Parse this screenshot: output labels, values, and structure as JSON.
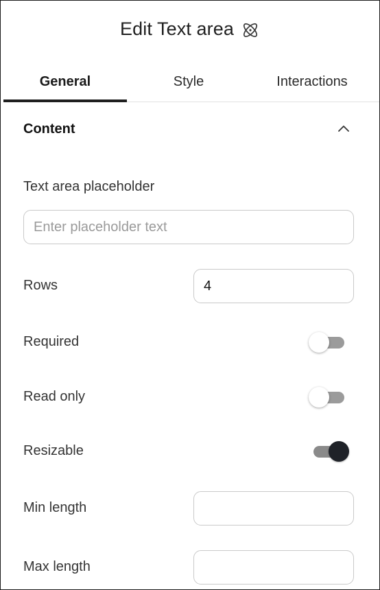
{
  "header": {
    "title": "Edit Text area",
    "icon": "atom-icon"
  },
  "tabs": [
    {
      "label": "General",
      "active": true
    },
    {
      "label": "Style",
      "active": false
    },
    {
      "label": "Interactions",
      "active": false
    }
  ],
  "section": {
    "title": "Content",
    "expanded": true,
    "icon": "chevron-up-icon"
  },
  "fields": {
    "placeholder": {
      "label": "Text area placeholder",
      "value": "",
      "placeholder": "Enter placeholder text"
    },
    "rows": {
      "label": "Rows",
      "value": "4"
    },
    "required": {
      "label": "Required",
      "on": false
    },
    "read_only": {
      "label": "Read only",
      "on": false
    },
    "resizable": {
      "label": "Resizable",
      "on": true
    },
    "min_length": {
      "label": "Min length",
      "value": ""
    },
    "max_length": {
      "label": "Max length",
      "value": ""
    }
  },
  "colors": {
    "active_tab_underline": "#1f1f1f",
    "toggle_on_knob": "#1f2228",
    "toggle_track": "#9b9b9b"
  }
}
